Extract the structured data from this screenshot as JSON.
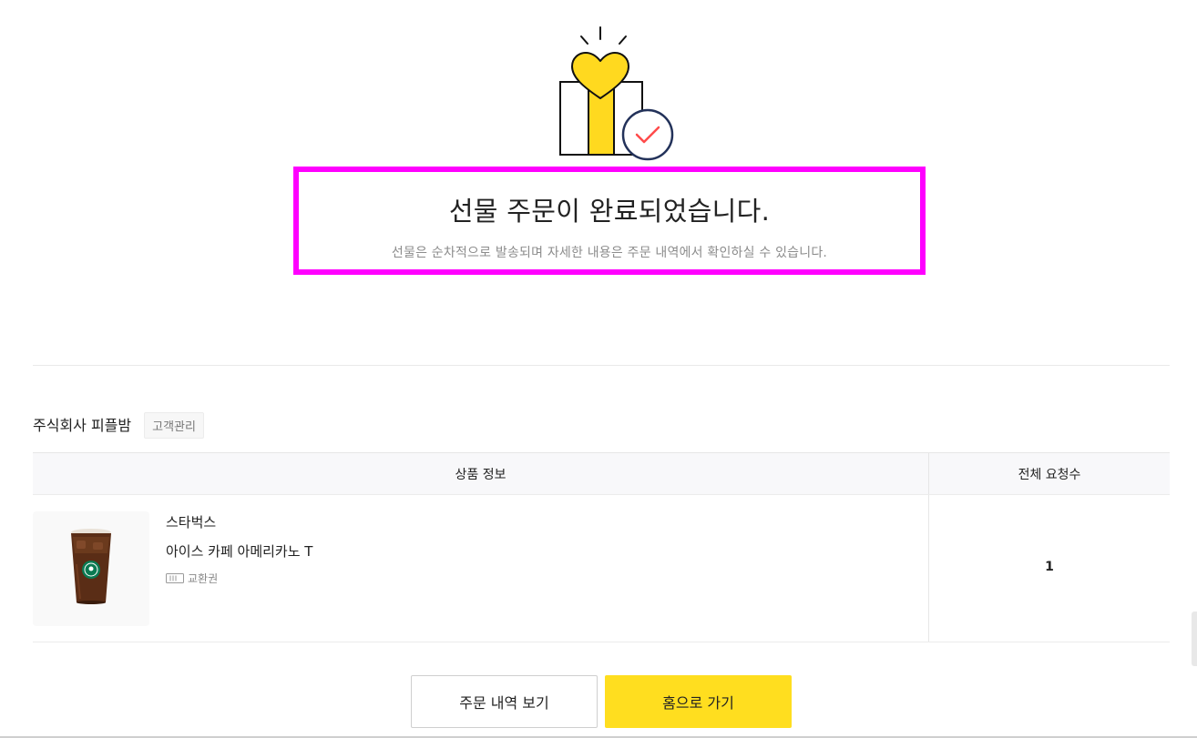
{
  "hero": {
    "icon": "gift-heart-check-icon",
    "colors": {
      "yellow": "#ffd91f",
      "outline": "#111111",
      "check": "#ff4b4b",
      "circle": "#23325a"
    }
  },
  "complete": {
    "title": "선물 주문이 완료되었습니다.",
    "subtitle": "선물은 순차적으로 발송되며 자세한 내용은 주문 내역에서 확인하실 수 있습니다."
  },
  "seller": {
    "name": "주식회사 피플밤",
    "badge": "고객관리"
  },
  "table": {
    "headers": {
      "product": "상품 정보",
      "count": "전체 요청수"
    },
    "rows": [
      {
        "brand": "스타벅스",
        "name": "아이스 카페 아메리카노 T",
        "type": "교환권",
        "type_icon": "ticket-icon",
        "thumb_icon": "iced-coffee-icon",
        "count": "1"
      }
    ]
  },
  "buttons": {
    "history": "주문 내역 보기",
    "home": "홈으로 가기"
  },
  "colors": {
    "highlight": "#ff00ff",
    "accent": "#ffde1f"
  }
}
